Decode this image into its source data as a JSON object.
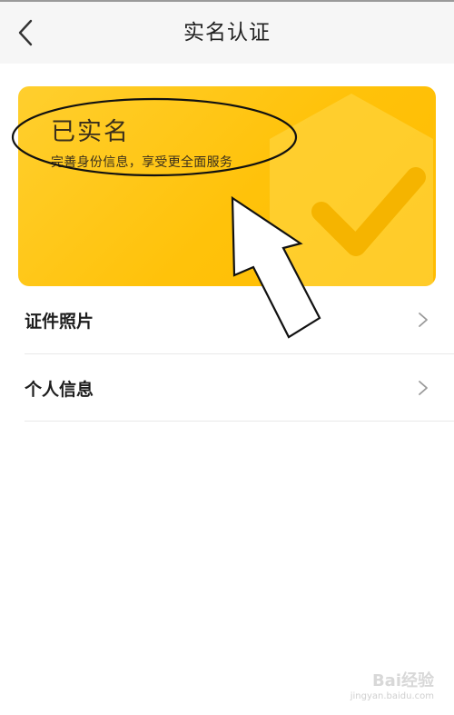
{
  "header": {
    "title": "实名认证",
    "back_icon": "chevron-left-icon"
  },
  "card": {
    "status": "已实名",
    "subtitle": "完善身份信息，享受更全面服务",
    "background_color": "#ffc20a",
    "emblem_icon": "shield-check-icon"
  },
  "list": {
    "items": [
      {
        "label": "证件照片",
        "icon": "chevron-right-icon"
      },
      {
        "label": "个人信息",
        "icon": "chevron-right-icon"
      }
    ]
  },
  "watermark": {
    "brand": "Bai经验",
    "url": "jingyan.baidu.com"
  }
}
